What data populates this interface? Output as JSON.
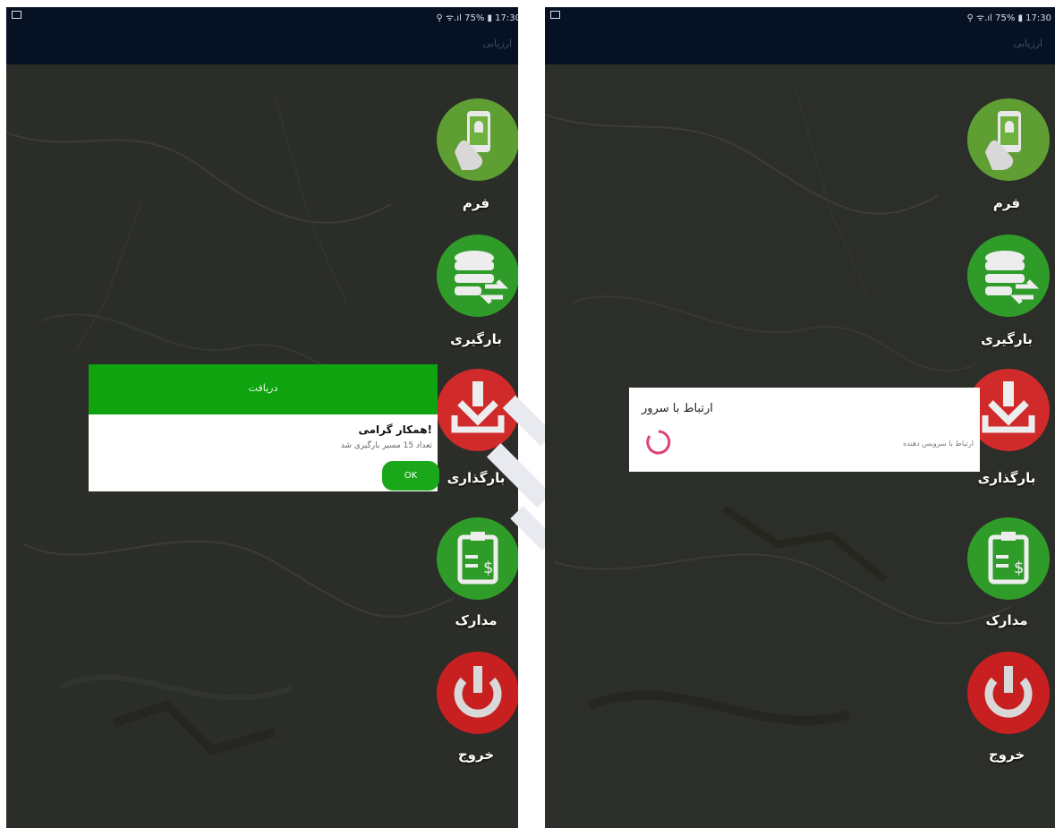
{
  "status_bar": {
    "right_text": "⚲ ᯤ.ıl 75% ▮ 17:30"
  },
  "app_title": "ارزیابی",
  "menu": [
    {
      "id": "form",
      "label": "فرم",
      "icon": "phone-android-icon",
      "color": "#6fb13d"
    },
    {
      "id": "load",
      "label": "بارگیری",
      "icon": "database-sync-icon",
      "color": "#36a92d"
    },
    {
      "id": "upload",
      "label": "بارگذاری",
      "icon": "download-tray-icon",
      "color": "#d62b2b"
    },
    {
      "id": "docs",
      "label": "مدارک",
      "icon": "document-money-icon",
      "color": "#36a92d"
    },
    {
      "id": "exit",
      "label": "خروج",
      "icon": "power-icon",
      "color": "#cf2424"
    }
  ],
  "receive_dialog": {
    "title": "دریافت",
    "heading": "همکار گرامی!",
    "message": "تعداد 15 مسیر بارگیری شد",
    "ok_label": "OK",
    "header_color": "#0fa30f"
  },
  "connect_dialog": {
    "title": "ارتباط با سرور",
    "message": "ارتباط با سرویس دهنده",
    "spinner_color": "#e0407a"
  }
}
